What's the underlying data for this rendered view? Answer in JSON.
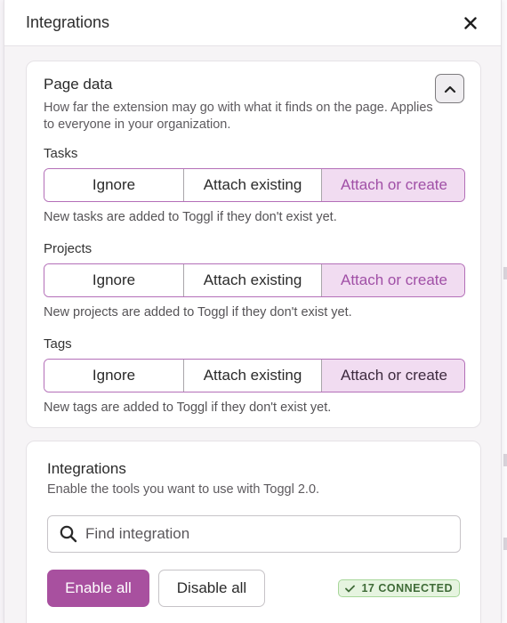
{
  "header": {
    "title": "Integrations"
  },
  "page_data": {
    "title": "Page data",
    "description": "How far the extension may go with what it finds on the page. Applies to everyone in your organization.",
    "groups": [
      {
        "label": "Tasks",
        "options": [
          "Ignore",
          "Attach existing",
          "Attach or create"
        ],
        "selected": "Attach or create",
        "helper": "New tasks are added to Toggl if they don't exist yet."
      },
      {
        "label": "Projects",
        "options": [
          "Ignore",
          "Attach existing",
          "Attach or create"
        ],
        "selected": "Attach or create",
        "helper": "New projects are added to Toggl if they don't exist yet."
      },
      {
        "label": "Tags",
        "options": [
          "Ignore",
          "Attach existing",
          "Attach or create"
        ],
        "selected": "Attach or create",
        "helper": "New tags are added to Toggl if they don't exist yet."
      }
    ]
  },
  "integrations": {
    "title": "Integrations",
    "description": "Enable the tools you want to use with Toggl 2.0.",
    "search_placeholder": "Find integration",
    "enable_all_label": "Enable all",
    "disable_all_label": "Disable all",
    "connected_badge": "17 CONNECTED"
  },
  "colors": {
    "accent": "#a8509f",
    "selected_bg": "#f1dcf1",
    "connected_green": "#3f6b37"
  },
  "icons": {
    "close": "close-icon",
    "collapse": "chevron-up-icon",
    "search": "search-icon",
    "check": "check-icon"
  }
}
